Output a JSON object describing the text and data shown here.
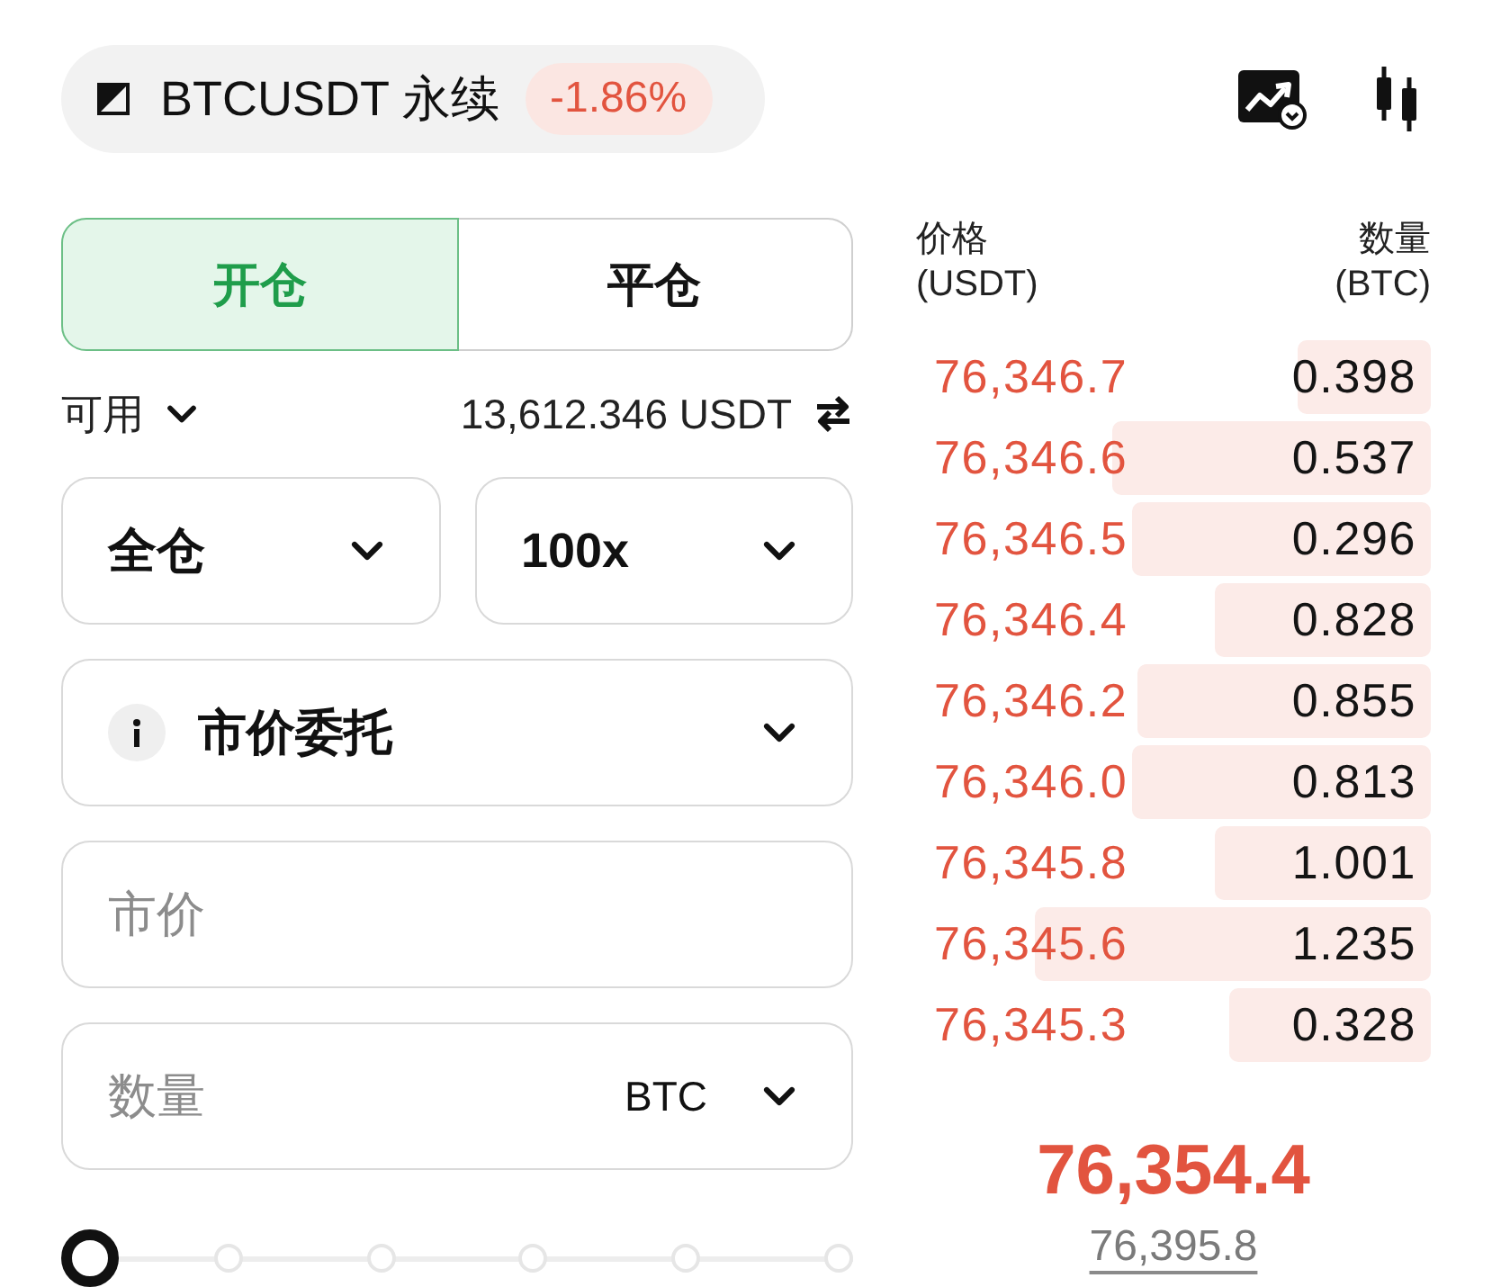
{
  "header": {
    "symbol": "BTCUSDT 永续",
    "change": "-1.86%"
  },
  "tabs": [
    {
      "label": "开仓",
      "selected": true
    },
    {
      "label": "平仓",
      "selected": false
    }
  ],
  "available": {
    "label": "可用",
    "amount": "13,612.346 USDT"
  },
  "margin_mode": {
    "value": "全仓"
  },
  "leverage": {
    "value": "100x"
  },
  "order_type": {
    "value": "市价委托"
  },
  "price_field": {
    "placeholder": "市价"
  },
  "quantity_field": {
    "placeholder": "数量",
    "unit": "BTC"
  },
  "size_slider": {
    "level": 0
  },
  "order_book": {
    "columns": [
      {
        "label": "价格",
        "unit": "(USDT)"
      },
      {
        "label": "数量",
        "unit": "(BTC)"
      }
    ],
    "asks": [
      {
        "price": "76,346.7",
        "quantity": "0.398",
        "level": 0.26
      },
      {
        "price": "76,346.6",
        "quantity": "0.537",
        "level": 0.62
      },
      {
        "price": "76,346.5",
        "quantity": "0.296",
        "level": 0.58
      },
      {
        "price": "76,346.4",
        "quantity": "0.828",
        "level": 0.42
      },
      {
        "price": "76,346.2",
        "quantity": "0.855",
        "level": 0.57
      },
      {
        "price": "76,346.0",
        "quantity": "0.813",
        "level": 0.58
      },
      {
        "price": "76,345.8",
        "quantity": "1.001",
        "level": 0.42
      },
      {
        "price": "76,345.6",
        "quantity": "1.235",
        "level": 0.77
      },
      {
        "price": "76,345.3",
        "quantity": "0.328",
        "level": 0.39
      }
    ],
    "last_price": "76,354.4",
    "mark_price": "76,395.8"
  }
}
